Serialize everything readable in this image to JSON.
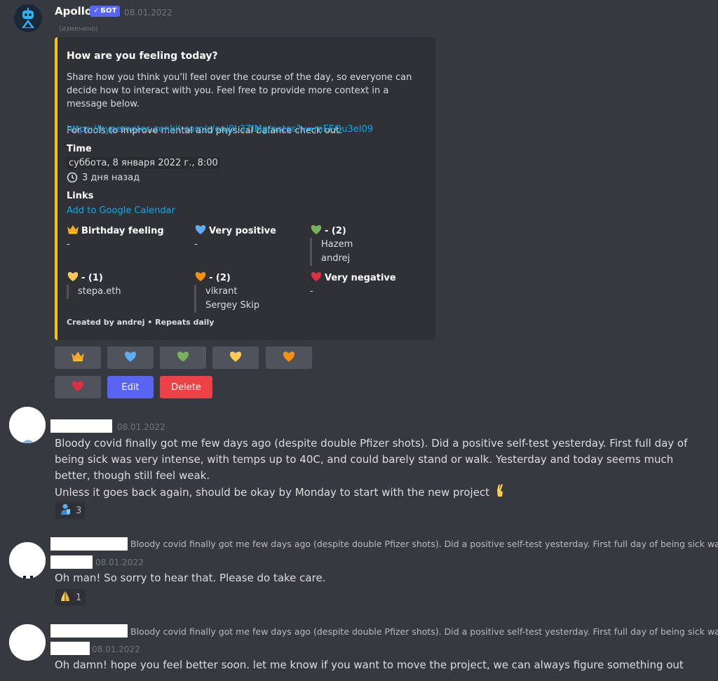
{
  "bot_message": {
    "author": "Apollo",
    "bot_tag": "БОТ",
    "timestamp": "08.01.2022",
    "edited": "(изменено)",
    "embed": {
      "title": "How are you feeling today?",
      "description": "Share how you think you'll feel over the course of the day, so everyone can decide how to interact with you. Feel free to provide more context in a message below.\n\nFor tools to improve mental and physical balance check out:",
      "link": "https://hypernotes.zenkit.com/c/ouj0L3ZIMg/notes?v=mEEQu3eI09",
      "time_label": "Time",
      "time_value": "суббота, 8 января 2022 г., 8:00",
      "time_relative": "3 дня назад",
      "links_label": "Links",
      "calendar_link": "Add to Google Calendar",
      "fields": [
        {
          "emoji": "crown-icon",
          "name": "Birthday feeling",
          "value": "-"
        },
        {
          "emoji": "blue-heart-icon",
          "name": "Very positive",
          "value": "-"
        },
        {
          "emoji": "green-heart-icon",
          "name": "- (2)",
          "users": [
            "Hazem",
            "andrej"
          ]
        },
        {
          "emoji": "yellow-heart-icon",
          "name": "- (1)",
          "users": [
            "stepa.eth"
          ]
        },
        {
          "emoji": "orange-heart-icon",
          "name": "- (2)",
          "users": [
            "vikrant",
            "Sergey Skip"
          ]
        },
        {
          "emoji": "red-heart-icon",
          "name": "Very negative",
          "value": "-"
        }
      ],
      "footer": "Created by andrej • Repeats daily"
    },
    "buttons": {
      "edit": "Edit",
      "delete": "Delete"
    }
  },
  "messages": [
    {
      "timestamp": "08.01.2022",
      "text": "Bloody covid finally got me few days ago (despite double Pfizer shots). Did a positive self-test yesterday. First full day of being sick was very intense, with temps up to 40C, and could barely stand or walk. Yesterday and today seems much better, though still feel weak.",
      "text2": "Unless it goes back again, should be okay by Monday to start with the new project",
      "reaction_count": "3"
    },
    {
      "reply": "Bloody covid finally got me few days ago (despite double Pfizer shots). Did a positive self-test yesterday. First full day of being sick was...",
      "timestamp": "08.01.2022",
      "text": "Oh man! So sorry to hear that. Please do take care.",
      "reaction_count": "1"
    },
    {
      "reply": "Bloody covid finally got me few days ago (despite double Pfizer shots). Did a positive self-test yesterday. First full day of being sick was...",
      "timestamp": "08.01.2022",
      "text": "Oh damn! hope you feel better soon. let me know if you want to move the project, we can always figure something out"
    }
  ],
  "colors": {
    "background": "#36393f",
    "embed_bg": "#2f3136",
    "embed_border": "#f5c518",
    "blurple": "#5865f2",
    "danger": "#ed4245",
    "link": "#00aff4"
  }
}
